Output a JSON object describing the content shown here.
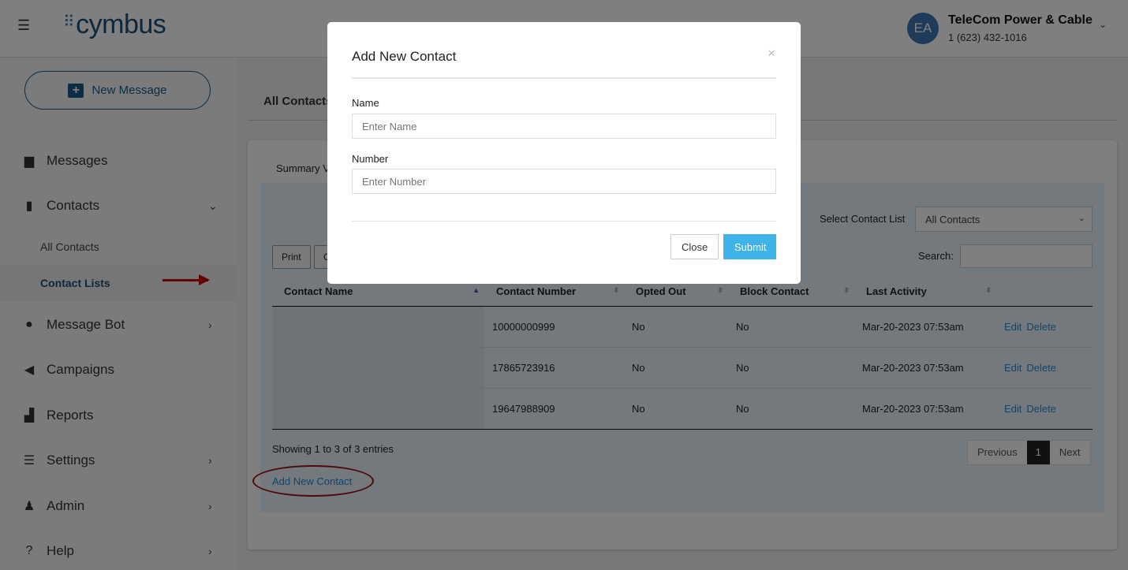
{
  "header": {
    "logo": "cymbus",
    "avatar_initials": "EA",
    "org_name": "TeleCom Power & Cable",
    "phone": "1 (623) 432-1016"
  },
  "sidebar": {
    "new_message": "New Message",
    "items": [
      {
        "label": "Messages",
        "icon": "chat-icon"
      },
      {
        "label": "Contacts",
        "icon": "contacts-book-icon",
        "sub": [
          "All Contacts",
          "Contact Lists"
        ]
      },
      {
        "label": "Message Bot",
        "icon": "robot-icon"
      },
      {
        "label": "Campaigns",
        "icon": "megaphone-icon"
      },
      {
        "label": "Reports",
        "icon": "bar-chart-icon"
      },
      {
        "label": "Settings",
        "icon": "sliders-icon"
      },
      {
        "label": "Admin",
        "icon": "admin-user-icon"
      },
      {
        "label": "Help",
        "icon": "help-icon"
      }
    ]
  },
  "main": {
    "tab": "All Contacts",
    "summary_tab": "Summary V",
    "select_label": "Select Contact List",
    "select_value": "All Contacts",
    "search_label": "Search:",
    "buttons": [
      "Print",
      "C"
    ],
    "columns": [
      "Contact Name",
      "Contact Number",
      "Opted Out",
      "Block Contact",
      "Last Activity"
    ],
    "rows": [
      {
        "name": "",
        "number": "10000000999",
        "opted": "No",
        "block": "No",
        "last": "Mar-20-2023 07:53am"
      },
      {
        "name": "",
        "number": "17865723916",
        "opted": "No",
        "block": "No",
        "last": "Mar-20-2023 07:53am"
      },
      {
        "name": "",
        "number": "19647988909",
        "opted": "No",
        "block": "No",
        "last": "Mar-20-2023 07:53am"
      }
    ],
    "edit": "Edit",
    "delete": "Delete",
    "showing": "Showing 1 to 3 of 3 entries",
    "pagination": {
      "previous": "Previous",
      "current": "1",
      "next": "Next"
    },
    "add_new_contact": "Add New Contact"
  },
  "modal": {
    "title": "Add New Contact",
    "close_x": "×",
    "name_label": "Name",
    "name_placeholder": "Enter Name",
    "number_label": "Number",
    "number_placeholder": "Enter Number",
    "close": "Close",
    "submit": "Submit"
  },
  "colors": {
    "brand": "#1a4f7a",
    "submit": "#3fb3e8",
    "annotation": "#c00000"
  }
}
